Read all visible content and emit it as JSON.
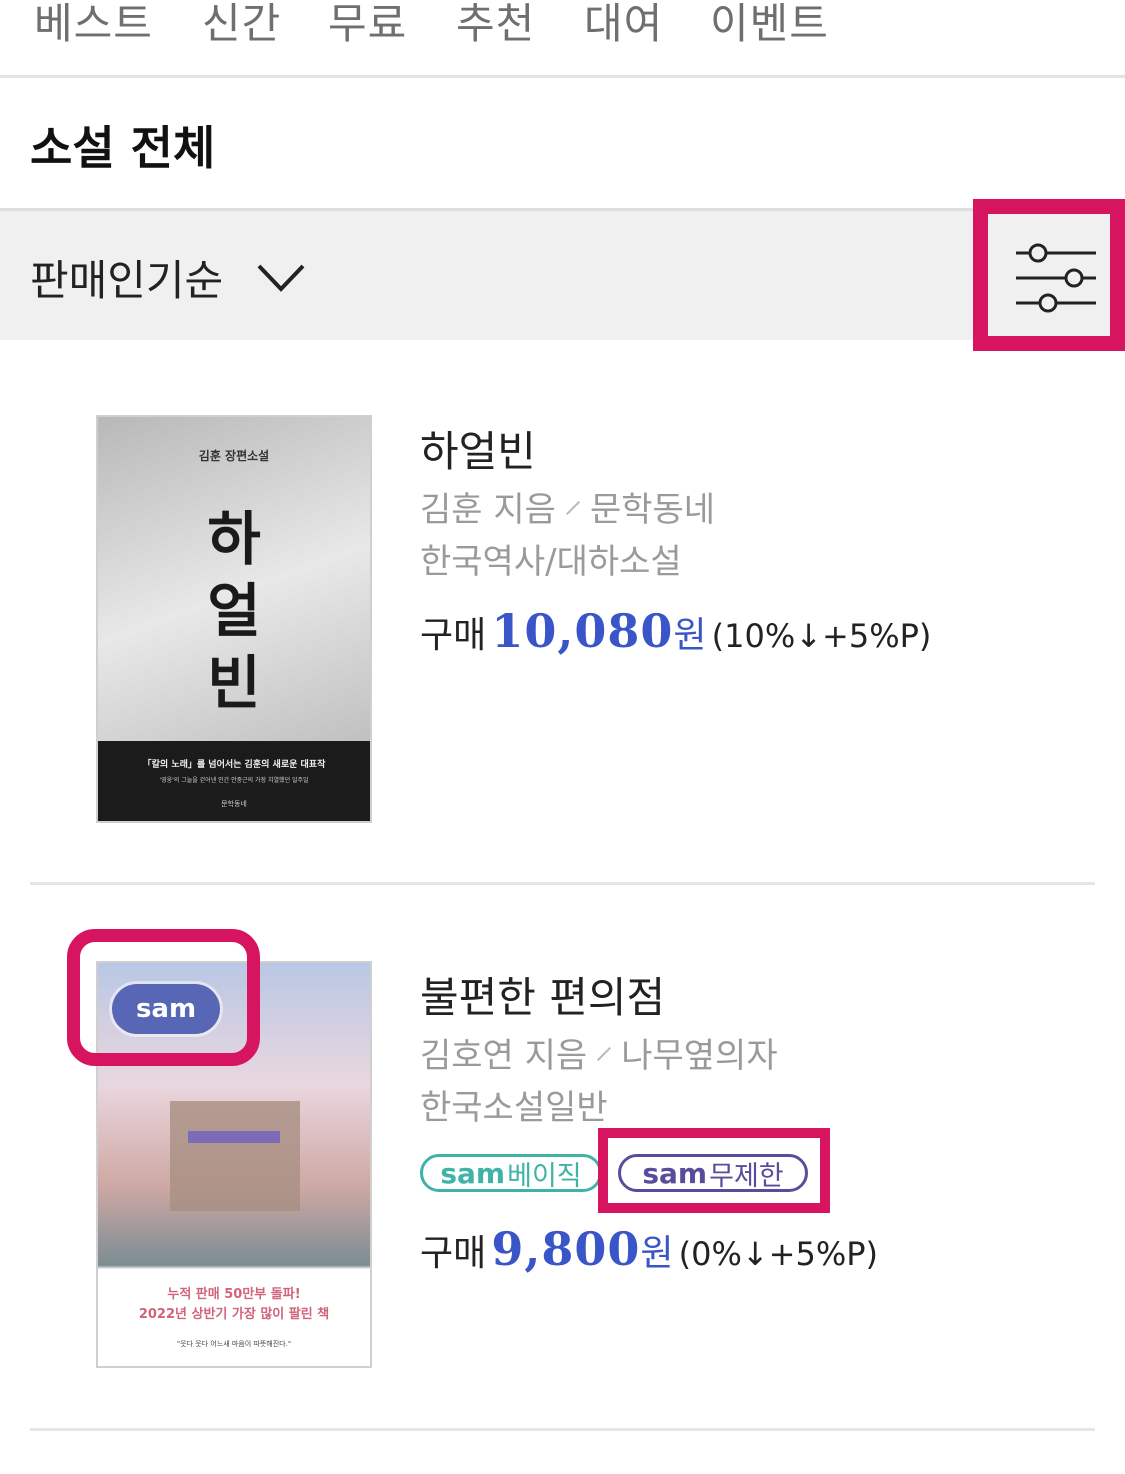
{
  "tabs": [
    {
      "label": "베스트"
    },
    {
      "label": "신간"
    },
    {
      "label": "무료"
    },
    {
      "label": "추천"
    },
    {
      "label": "대여"
    },
    {
      "label": "이벤트"
    }
  ],
  "section_title": "소설 전체",
  "sort": {
    "label": "판매인기순",
    "chevron_icon": "chevron-down-icon",
    "filter_icon": "sliders-icon"
  },
  "books": [
    {
      "title": "하얼빈",
      "author": "김훈 지음",
      "publisher": "문학동네",
      "category": "한국역사/대하소설",
      "price_label": "구매",
      "price": "10,080",
      "currency": "원",
      "discount": "(10%↓+5%P)",
      "cover": {
        "series": "김훈 장편소설",
        "big_title": [
          "하",
          "얼",
          "빈"
        ],
        "band_headline": "「칼의 노래」를 넘어서는 김훈의 새로운 대표작",
        "band_sub": "'영웅'의 그늘을 걷어낸 인간 안중근의 가장 치열했던 일주일",
        "band_pub": "문학동네"
      }
    },
    {
      "title": "불편한 편의점",
      "author": "김호연 지음",
      "publisher": "나무옆의자",
      "category": "한국소설일반",
      "price_label": "구매",
      "price": "9,800",
      "currency": "원",
      "discount": "(0%↓+5%P)",
      "sam_pill": "sam",
      "badges": [
        {
          "sam": "sam",
          "text": "베이직"
        },
        {
          "sam": "sam",
          "text": "무제한"
        }
      ],
      "cover": {
        "banner_line1": "누적 판매 50만부 돌파!",
        "banner_line2": "2022년 상반기 가장 많이 팔린 책",
        "quote": "\"웃다 웃다 어느새 마음이 따뜻해진다.\""
      }
    }
  ],
  "colors": {
    "highlight": "#d6145f",
    "price": "#3a55c8",
    "sam_basic": "#3fb3a8",
    "sam_unlimited": "#5b4b9d"
  }
}
